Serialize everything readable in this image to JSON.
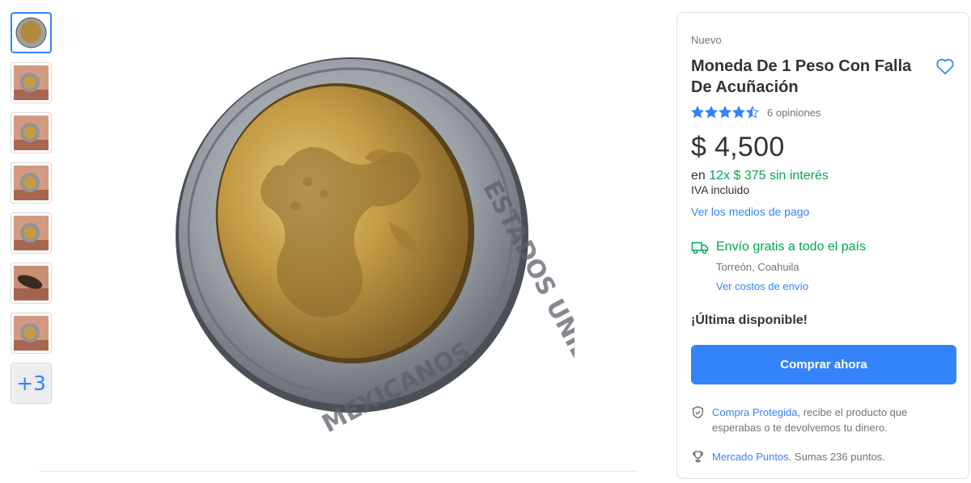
{
  "thumbnails": {
    "items": [
      {
        "kind": "coin-front",
        "active": true
      },
      {
        "kind": "coin-hand",
        "active": false
      },
      {
        "kind": "coin-hand",
        "active": false
      },
      {
        "kind": "coin-hand",
        "active": false
      },
      {
        "kind": "coin-hand",
        "active": false
      },
      {
        "kind": "coin-edge",
        "active": false
      },
      {
        "kind": "coin-hand",
        "active": false
      }
    ],
    "more_label": "+3"
  },
  "gallery": {
    "image": "bimetallic-coin-main-photo",
    "inner_text_top": "ESTADOS UNIDOS",
    "inner_text_bottom": "MEXICANOS"
  },
  "product": {
    "condition": "Nuevo",
    "title": "Moneda De 1 Peso Con Falla De Acuñación",
    "rating": 4.5,
    "rating_count_label": "6 opiniones",
    "price": "$ 4,500",
    "installments_prefix": "en ",
    "installments_highlight": "12x $ 375 sin interés",
    "iva": "IVA incluido",
    "payment_methods_link": "Ver los medios de pago"
  },
  "shipping": {
    "main": "Envío gratis a todo el país",
    "origin": "Torreón, Coahuila",
    "costs_link": "Ver costos de envío"
  },
  "stock": {
    "label": "¡Última disponible!"
  },
  "actions": {
    "buy_now": "Comprar ahora"
  },
  "benefits": {
    "protected_link": "Compra Protegida",
    "protected_text": ", recibe el producto que esperabas o te devolvemos tu dinero.",
    "points_link": "Mercado Puntos",
    "points_text": ". Sumas 236 puntos."
  },
  "colors": {
    "accent": "#3483fa",
    "success": "#00a650",
    "text": "#333333",
    "muted": "#737373"
  },
  "icons": {
    "favorite": "heart-outline-icon",
    "shipping": "truck-icon",
    "protected": "shield-check-icon",
    "points": "trophy-icon",
    "star": "star-icon"
  }
}
